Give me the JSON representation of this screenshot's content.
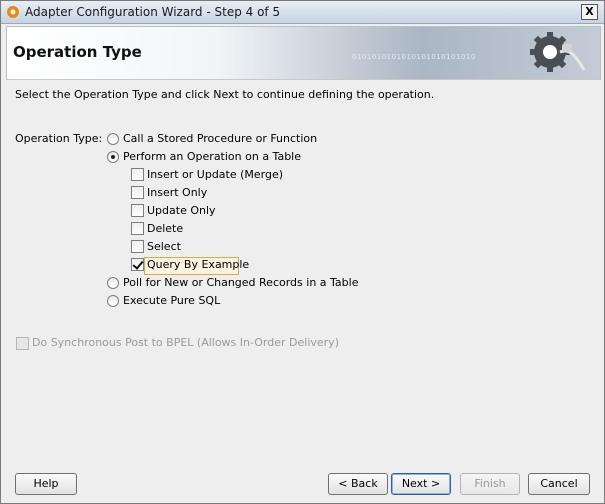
{
  "window": {
    "title": "Adapter Configuration Wizard - Step 4 of 5",
    "close_label": "X"
  },
  "banner": {
    "heading": "Operation Type",
    "binary_text": "0101010101010101010101010"
  },
  "instructions": "Select the Operation Type and click Next to continue defining the operation.",
  "operation_label": "Operation Type:",
  "radios": [
    {
      "label": "Call a Stored Procedure or Function",
      "selected": false
    },
    {
      "label": "Perform an Operation on a Table",
      "selected": true
    },
    {
      "label": "Poll for New or Changed Records in a Table",
      "selected": false
    },
    {
      "label": "Execute Pure SQL",
      "selected": false
    }
  ],
  "table_ops": [
    {
      "label": "Insert or Update (Merge)",
      "checked": false
    },
    {
      "label": "Insert Only",
      "checked": false
    },
    {
      "label": "Update Only",
      "checked": false
    },
    {
      "label": "Delete",
      "checked": false
    },
    {
      "label": "Select",
      "checked": false
    },
    {
      "label": "Query By Example",
      "checked": true
    }
  ],
  "sync_post": {
    "label": "Do Synchronous Post to BPEL (Allows In-Order Delivery)",
    "checked": false,
    "enabled": false
  },
  "buttons": {
    "help": "Help",
    "back": "< Back",
    "next": "Next >",
    "finish": "Finish",
    "cancel": "Cancel"
  }
}
